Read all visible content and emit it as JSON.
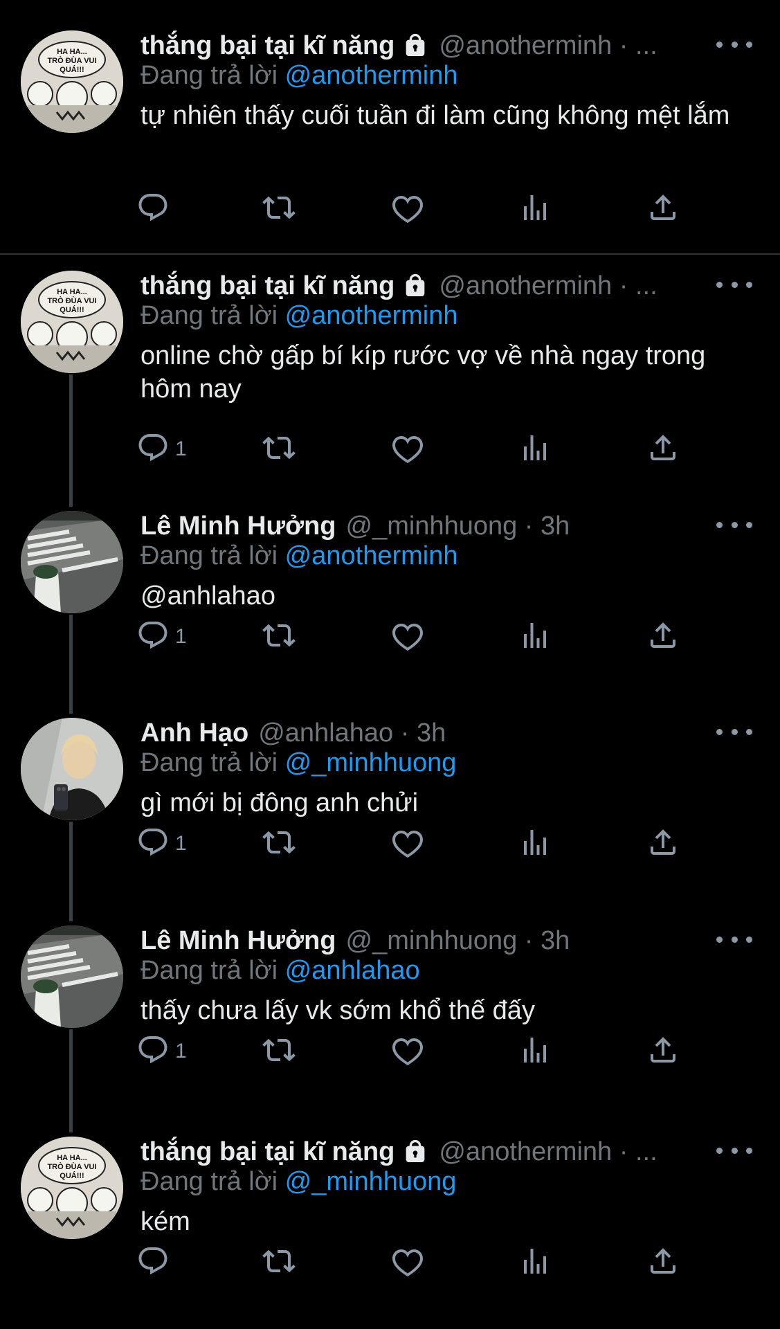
{
  "tweets": [
    {
      "name": "thắng bại tại kĩ năng",
      "locked": true,
      "handle": "@anotherminh · ...",
      "replying_prefix": "Đang trả lời ",
      "replying_to": "@anotherminh",
      "text": "tự nhiên thấy cuối tuần đi làm cũng không mệt lắm",
      "reply_count": "",
      "avatar": "comic"
    },
    {
      "name": "thắng bại tại kĩ năng",
      "locked": true,
      "handle": "@anotherminh · ...",
      "replying_prefix": "Đang trả lời ",
      "replying_to": "@anotherminh",
      "text": "online chờ gấp bí kíp rước vợ về nhà ngay trong hôm nay",
      "reply_count": "1",
      "avatar": "comic"
    },
    {
      "name": "Lê Minh Hưởng",
      "locked": false,
      "handle": "@_minhhuong · 3h",
      "replying_prefix": "Đang trả lời ",
      "replying_to": "@anotherminh",
      "text": "@anhlahao",
      "text_is_mention": true,
      "reply_count": "1",
      "avatar": "street"
    },
    {
      "name": "Anh Hạo",
      "locked": false,
      "handle": "@anhlahao · 3h",
      "replying_prefix": "Đang trả lời ",
      "replying_to": "@_minhhuong",
      "text": "gì mới bị đông anh chửi",
      "reply_count": "1",
      "avatar": "selfie"
    },
    {
      "name": "Lê Minh Hưởng",
      "locked": false,
      "handle": "@_minhhuong · 3h",
      "replying_prefix": "Đang trả lời ",
      "replying_to": "@anhlahao",
      "text": "thấy chưa lấy vk sớm khổ thế đấy",
      "reply_count": "1",
      "avatar": "street"
    },
    {
      "name": "thắng bại tại kĩ năng",
      "locked": true,
      "handle": "@anotherminh · ...",
      "replying_prefix": "Đang trả lời ",
      "replying_to": "@_minhhuong",
      "text": "kém",
      "reply_count": "",
      "avatar": "comic"
    }
  ],
  "avatar_comic_text": [
    "HA HA...",
    "TRÒ ĐÙA VUI",
    "QUÁ!!!"
  ],
  "icons": {
    "lock": "lock-icon",
    "reply": "reply-icon",
    "retweet": "retweet-icon",
    "like": "heart-icon",
    "views": "views-icon",
    "share": "share-icon",
    "more": "more-icon"
  },
  "colors": {
    "background": "#000000",
    "text": "#e7e9ea",
    "secondary": "#71767b",
    "link": "#1d9bf0",
    "icon": "#8b98a5"
  }
}
